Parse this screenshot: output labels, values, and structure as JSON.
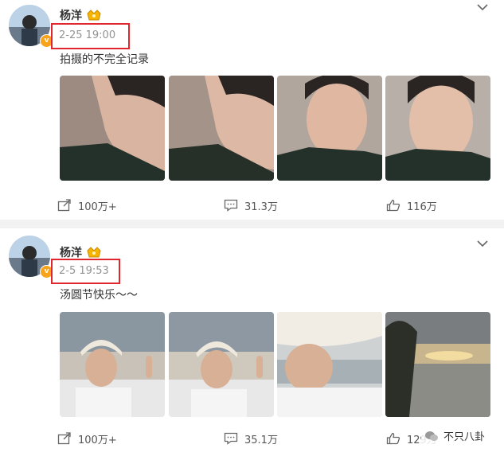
{
  "posts": [
    {
      "author": "杨洋",
      "time": "2-25 19:00",
      "text": "拍摄的不完全记录",
      "photos": [
        "selfie-left-profile-1",
        "selfie-left-profile-2",
        "selfie-front-1",
        "selfie-front-2"
      ],
      "repost_count": "100万+",
      "comment_count": "31.3万",
      "like_count": "116万"
    },
    {
      "author": "杨洋",
      "time": "2-5 19:53",
      "text": "汤圆节快乐～～",
      "photos": [
        "cap-peace-sign-sea-1",
        "cap-peace-sign-sea-2",
        "cap-closeup-sea",
        "sunset-sea-cliff"
      ],
      "repost_count": "100万+",
      "comment_count": "35.1万",
      "like_count": "129万"
    }
  ],
  "watermark": {
    "label": "不只八卦"
  },
  "colors": {
    "highlight": "#e1262d",
    "verified": "#f7a41c",
    "meta_text": "#939393"
  }
}
